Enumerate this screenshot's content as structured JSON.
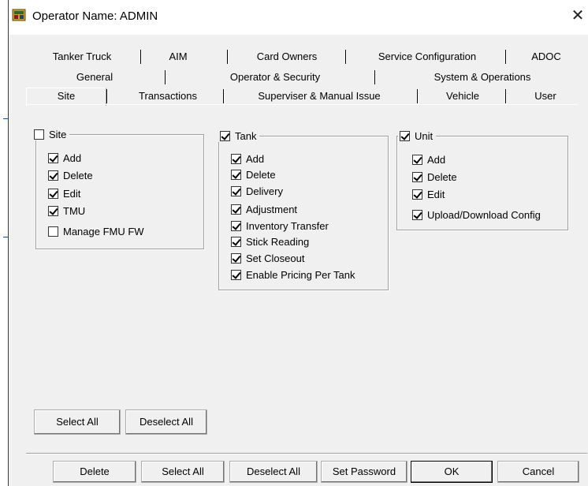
{
  "window": {
    "title": "Operator Name: ADMIN",
    "close_glyph": "✕"
  },
  "tabs": {
    "row1": [
      "Tanker Truck",
      "AIM",
      "Card Owners",
      "Service Configuration",
      "ADOC"
    ],
    "row2": [
      "General",
      "Operator & Security",
      "System & Operations"
    ],
    "row3": [
      "Site",
      "Transactions",
      "Superviser & Manual Issue",
      "Vehicle",
      "User"
    ],
    "active": "Site"
  },
  "groups": {
    "site": {
      "label": "Site",
      "checked": false,
      "items": [
        {
          "label": "Add",
          "checked": true
        },
        {
          "label": "Delete",
          "checked": true
        },
        {
          "label": "Edit",
          "checked": true
        },
        {
          "label": "TMU",
          "checked": true
        },
        {
          "label": "Manage FMU FW",
          "checked": false
        }
      ]
    },
    "tank": {
      "label": "Tank",
      "checked": true,
      "items": [
        {
          "label": "Add",
          "checked": true
        },
        {
          "label": "Delete",
          "checked": true
        },
        {
          "label": "Delivery",
          "checked": true
        },
        {
          "label": "Adjustment",
          "checked": true
        },
        {
          "label": "Inventory Transfer",
          "checked": true
        },
        {
          "label": "Stick Reading",
          "checked": true
        },
        {
          "label": "Set Closeout",
          "checked": true
        },
        {
          "label": "Enable Pricing Per Tank",
          "checked": true
        }
      ]
    },
    "unit": {
      "label": "Unit",
      "checked": true,
      "items": [
        {
          "label": "Add",
          "checked": true
        },
        {
          "label": "Delete",
          "checked": true
        },
        {
          "label": "Edit",
          "checked": true
        },
        {
          "label": "Upload/Download Config",
          "checked": true
        }
      ]
    }
  },
  "panel_buttons": {
    "select_all": "Select All",
    "deselect_all": "Deselect All"
  },
  "footer_buttons": {
    "delete": "Delete",
    "select_all": "Select All",
    "deselect_all": "Deselect All",
    "set_password": "Set Password",
    "ok": "OK",
    "cancel": "Cancel"
  }
}
